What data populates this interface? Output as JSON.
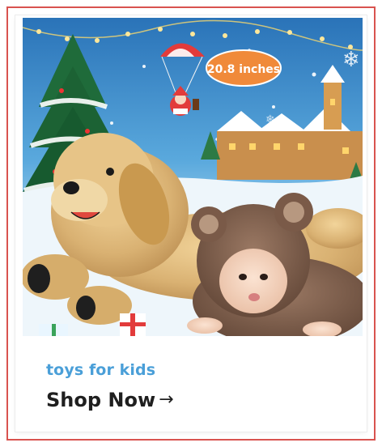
{
  "promo": {
    "size_badge": "20.8 inches",
    "category": "toys for kids",
    "cta_label": "Shop Now",
    "arrow_glyph": "→"
  },
  "colors": {
    "frame_border": "#d9534f",
    "category_text": "#4a9fd8",
    "cta_text": "#1f1f1f",
    "badge_bg": "#f08a3a"
  },
  "icons": [
    "arrow-right-icon"
  ]
}
